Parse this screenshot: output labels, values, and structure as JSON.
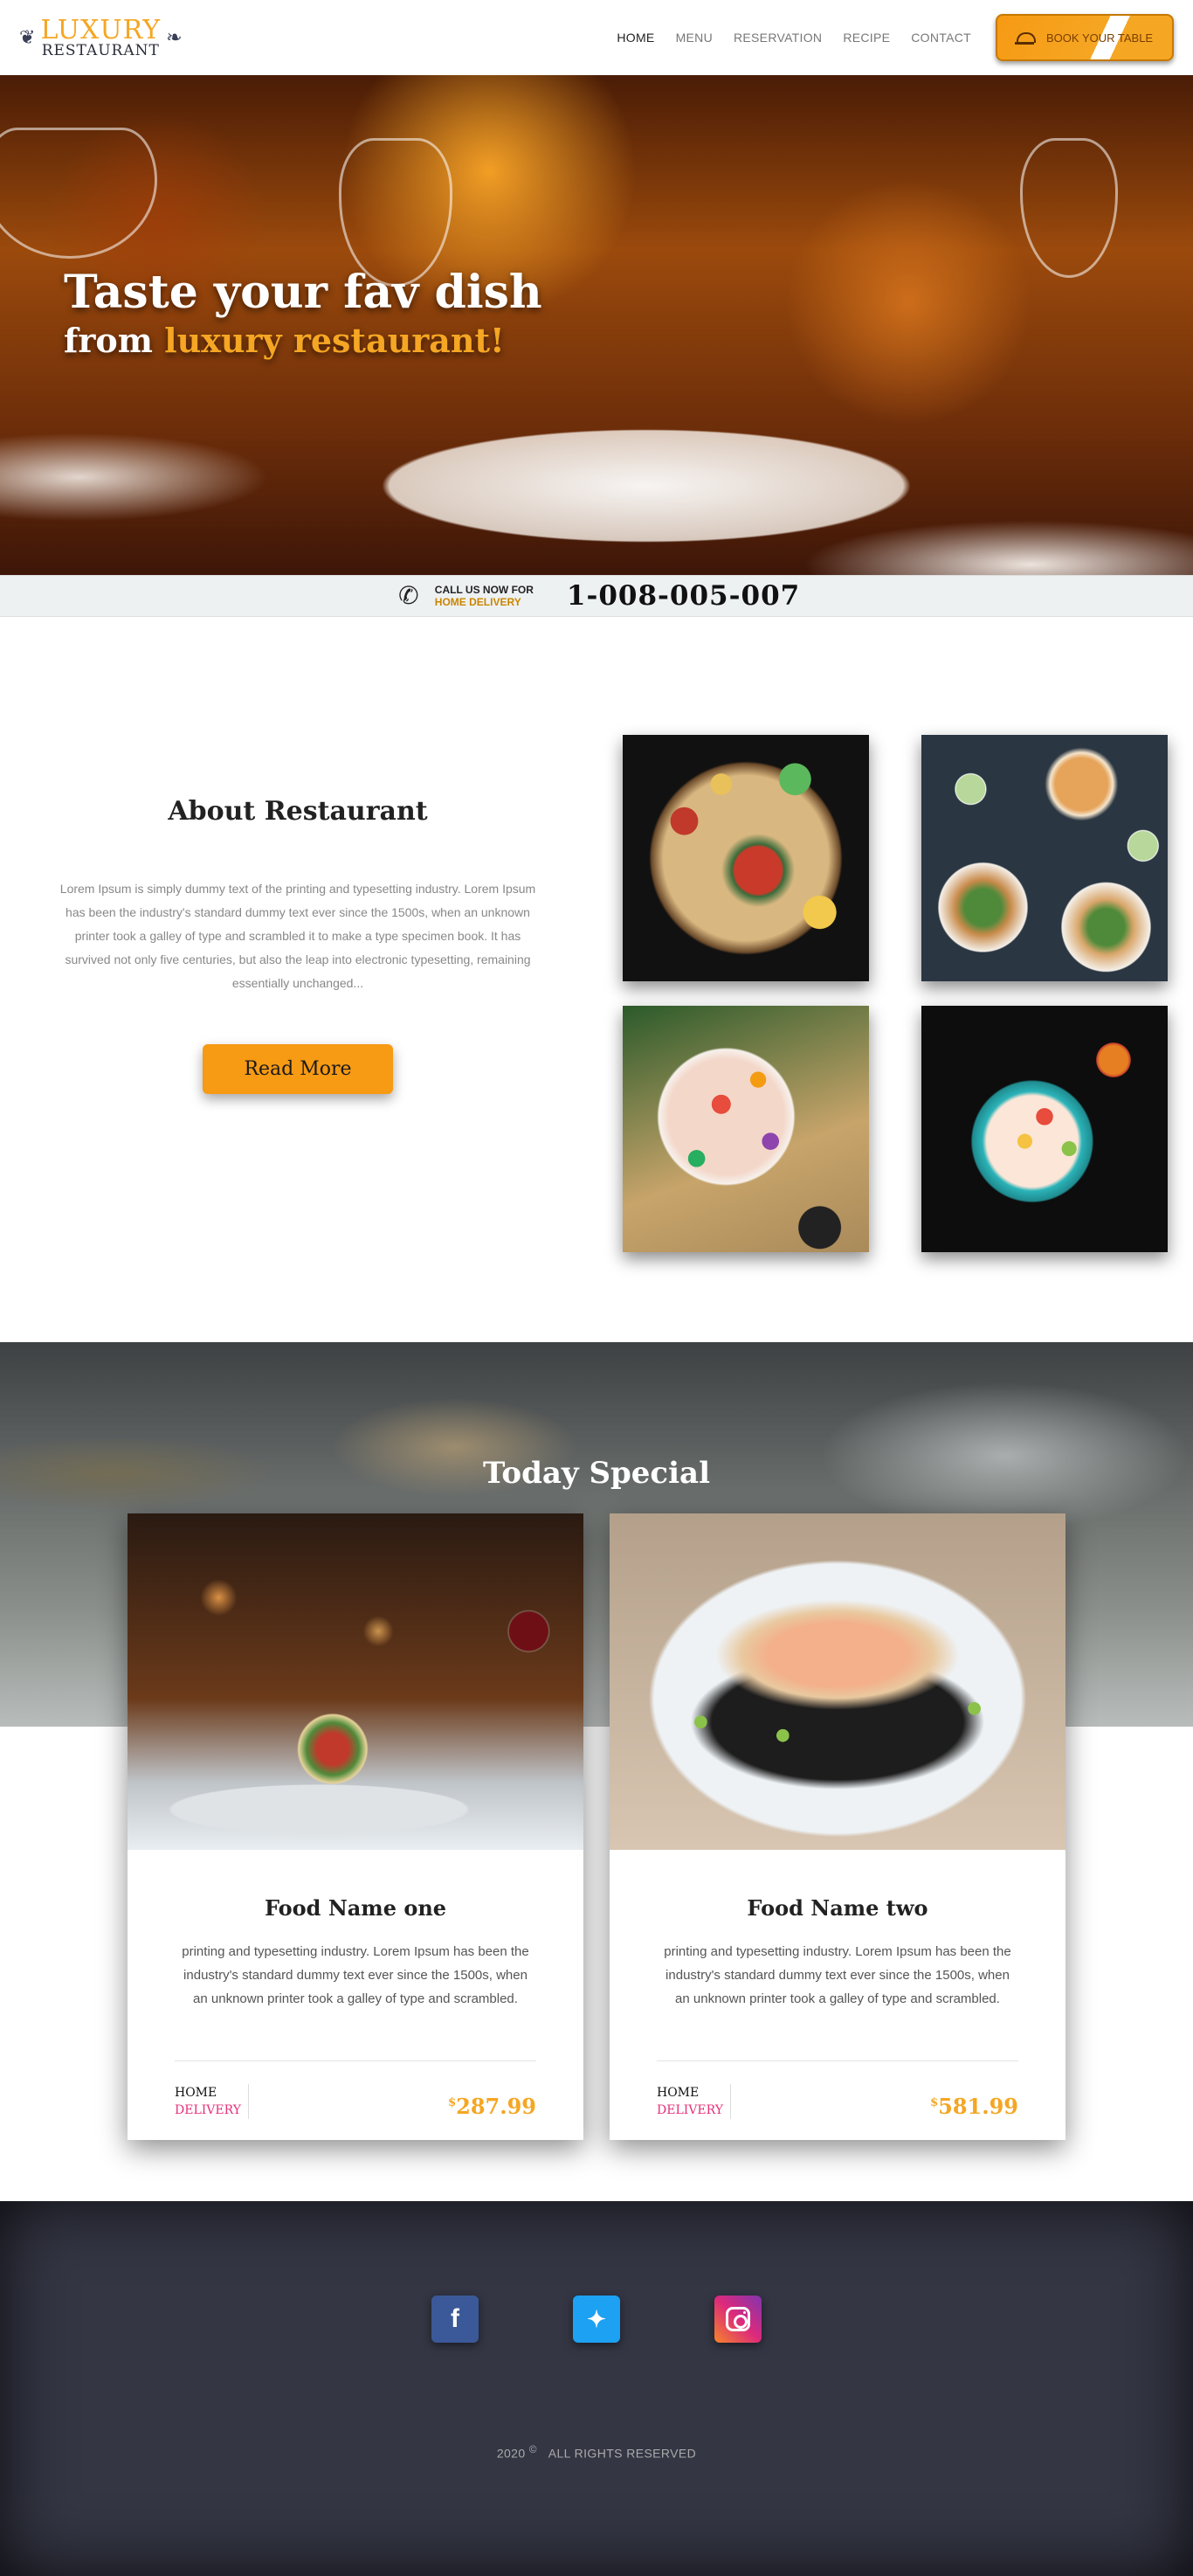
{
  "brand": {
    "logo_top": "LUXURY",
    "logo_bottom": "RESTAURANT"
  },
  "nav": {
    "items": [
      {
        "label": "HOME",
        "active": true
      },
      {
        "label": "MENU",
        "active": false
      },
      {
        "label": "RESERVATION",
        "active": false
      },
      {
        "label": "RECIPE",
        "active": false
      },
      {
        "label": "CONTACT",
        "active": false
      }
    ],
    "cta_label": "BOOK YOUR TABLE"
  },
  "hero": {
    "line1": "Taste your fav dish",
    "line2_prefix": "from",
    "line2_accent": "luxury restaurant!"
  },
  "callbar": {
    "label": "CALL US NOW FOR",
    "sublabel": "HOME DELIVERY",
    "number": "1-008-005-007"
  },
  "about": {
    "title": "About Restaurant",
    "body": "Lorem Ipsum is simply dummy text of the printing and typesetting industry. Lorem Ipsum has been the industry's standard dummy text ever since the 1500s, when an unknown printer took a galley of type and scrambled it to make a type specimen book. It has survived not only five centuries, but also the leap into electronic typesetting, remaining essentially unchanged...",
    "button": "Read More"
  },
  "special": {
    "title": "Today Special",
    "cards": [
      {
        "name": "Food Name one",
        "description": "printing and typesetting industry. Lorem Ipsum has been the industry's standard dummy text ever since the 1500s, when an unknown printer took a galley of type and scrambled.",
        "tag_top": "HOME",
        "tag_bottom": "DELIVERY",
        "currency": "$",
        "price": "287.99"
      },
      {
        "name": "Food Name two",
        "description": "printing and typesetting industry. Lorem Ipsum has been the industry's standard dummy text ever since the 1500s, when an unknown printer took a galley of type and scrambled.",
        "tag_top": "HOME",
        "tag_bottom": "DELIVERY",
        "currency": "$",
        "price": "581.99"
      }
    ]
  },
  "footer": {
    "socials": [
      "facebook-icon",
      "twitter-icon",
      "instagram-icon"
    ],
    "year": "2020",
    "copyright_symbol": "©",
    "rights": "ALL RIGHTS RESERVED"
  },
  "colors": {
    "accent": "#f5a623",
    "delivery": "#e6307a",
    "footer": "#343644"
  }
}
